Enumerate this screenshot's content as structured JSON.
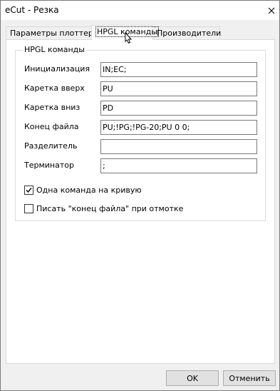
{
  "window": {
    "title": "eCut - Резка"
  },
  "tabs": [
    {
      "label": "Параметры плоттера"
    },
    {
      "label": "HPGL команды"
    },
    {
      "label": "Производители"
    }
  ],
  "group": {
    "title": "HPGL команды",
    "fields": [
      {
        "label": "Инициализация",
        "value": "IN;EC;"
      },
      {
        "label": "Каретка вверх",
        "value": "PU"
      },
      {
        "label": "Каретка вниз",
        "value": "PD"
      },
      {
        "label": "Конец файла",
        "value": "PU;!PG;!PG-20;PU 0 0;"
      },
      {
        "label": "Разделитель",
        "value": ""
      },
      {
        "label": "Терминатор",
        "value": ";"
      }
    ],
    "checkboxes": [
      {
        "label": "Одна команда на кривую",
        "checked": true
      },
      {
        "label": "Писать \"конец файла\" при отмотке",
        "checked": false
      }
    ]
  },
  "buttons": {
    "ok": "OK",
    "cancel": "Отменить"
  }
}
